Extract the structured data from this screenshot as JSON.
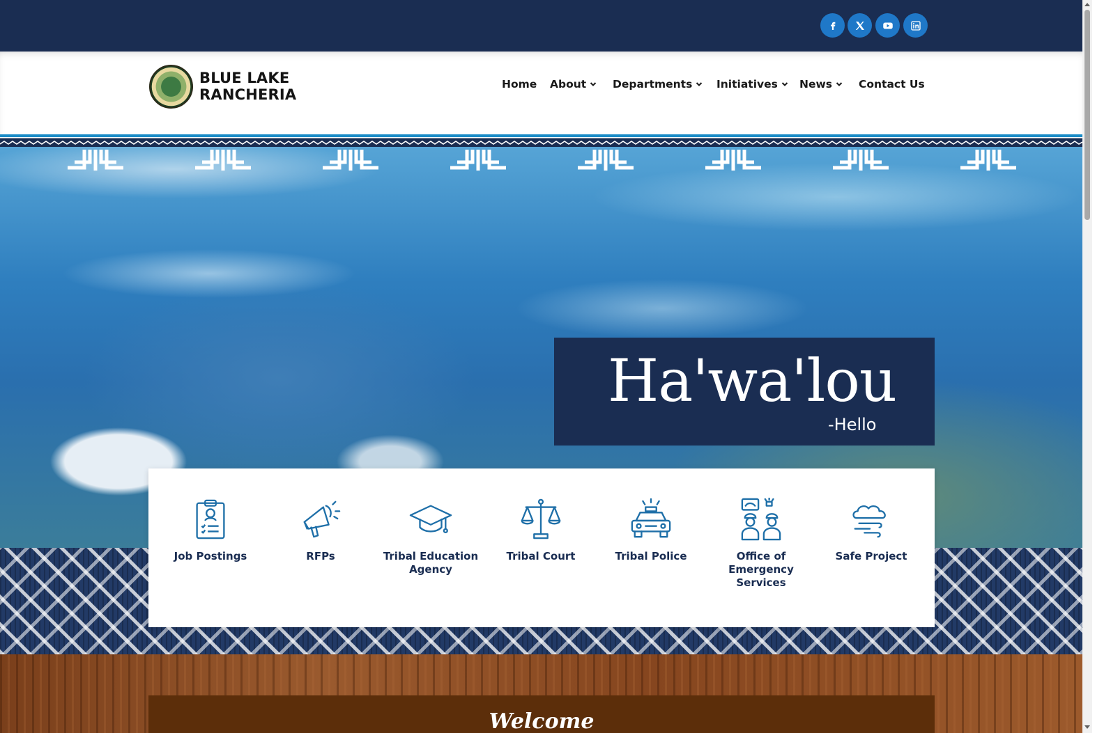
{
  "social": {
    "icons": [
      "facebook-icon",
      "x-twitter-icon",
      "youtube-icon",
      "linkedin-icon"
    ],
    "color": "#1f78c8"
  },
  "brand": {
    "line1": "BLUE LAKE",
    "line2": "RANCHERIA"
  },
  "nav": {
    "items": [
      {
        "label": "Home",
        "dropdown": false
      },
      {
        "label": "About",
        "dropdown": true
      },
      {
        "label": "Departments",
        "dropdown": true
      },
      {
        "label": "Initiatives",
        "dropdown": true
      },
      {
        "label": "News",
        "dropdown": true
      },
      {
        "label": "Contact Us",
        "dropdown": false
      }
    ]
  },
  "hero": {
    "greeting": "Ha'wa'lou",
    "translation": "-Hello"
  },
  "quick_links": [
    {
      "label": "Job Postings",
      "icon": "clipboard-profile-icon"
    },
    {
      "label": "RFPs",
      "icon": "megaphone-icon"
    },
    {
      "label": "Tribal Education Agency",
      "icon": "graduation-cap-icon"
    },
    {
      "label": "Tribal Court",
      "icon": "scales-of-justice-icon"
    },
    {
      "label": "Tribal Police",
      "icon": "police-car-icon"
    },
    {
      "label": "Office of Emergency Services",
      "icon": "emergency-responders-icon"
    },
    {
      "label": "Safe Project",
      "icon": "wind-cloud-icon"
    }
  ],
  "welcome": {
    "title": "Welcome"
  },
  "colors": {
    "navy": "#1a2d52",
    "accent_blue": "#1f78c8",
    "icon_blue": "#1e6fa8",
    "wood_brown": "#5c2e0a"
  }
}
